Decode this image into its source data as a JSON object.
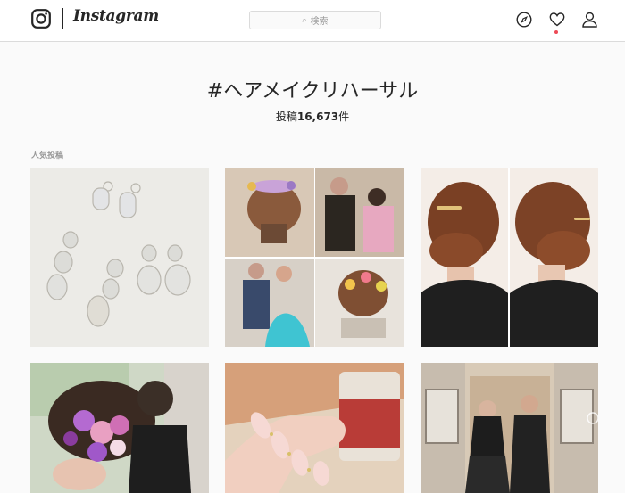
{
  "header": {
    "brand": "Instagram",
    "search_placeholder": "検索",
    "icons": [
      "camera-logo-icon",
      "compass-icon",
      "heart-icon",
      "user-icon"
    ],
    "notification_color": "#ed4956"
  },
  "hashtag": {
    "title": "#ヘアメイクリハーサル",
    "count_prefix": "投稿",
    "count": "16,673",
    "count_suffix": "件"
  },
  "section": {
    "label": "人気投稿"
  },
  "posts": [
    {
      "subject": "earrings"
    },
    {
      "subject": "hair-collage"
    },
    {
      "subject": "updo-back"
    },
    {
      "subject": "flower-hair"
    },
    {
      "subject": "nails"
    },
    {
      "subject": "couple"
    }
  ]
}
